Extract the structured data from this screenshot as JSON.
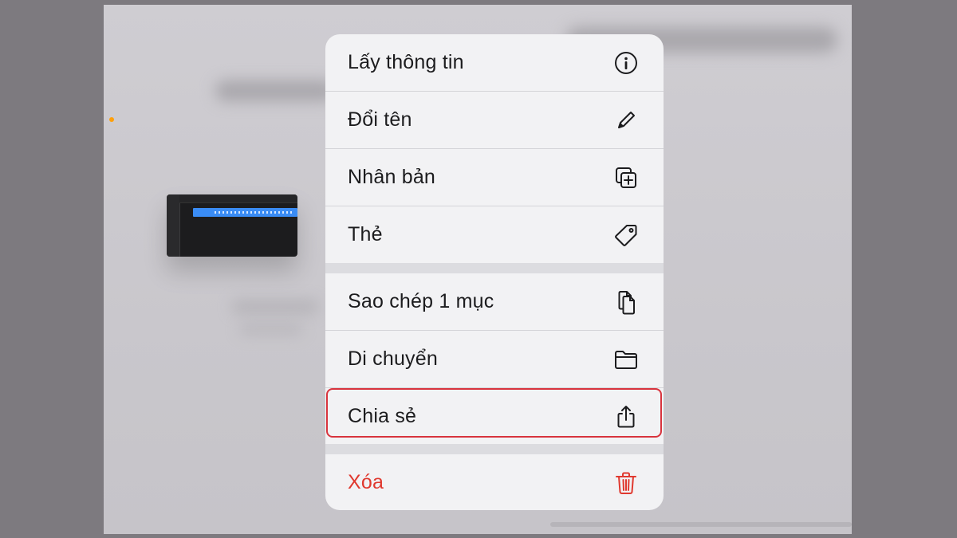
{
  "menu": {
    "group1": [
      {
        "label": "Lấy thông tin",
        "icon": "info-icon"
      },
      {
        "label": "Đổi tên",
        "icon": "pencil-icon"
      },
      {
        "label": "Nhân bản",
        "icon": "duplicate-icon"
      },
      {
        "label": "Thẻ",
        "icon": "tag-icon"
      }
    ],
    "group2": [
      {
        "label": "Sao chép 1 mục",
        "icon": "copy-icon"
      },
      {
        "label": "Di chuyển",
        "icon": "folder-icon"
      },
      {
        "label": "Chia sẻ",
        "icon": "share-icon",
        "highlighted": true
      }
    ],
    "group3": [
      {
        "label": "Xóa",
        "icon": "trash-icon",
        "destructive": true
      }
    ]
  },
  "colors": {
    "destructive": "#e0392f",
    "highlight_border": "#d8333d",
    "accent_region": "#3a8cf5",
    "orange_dot": "#ff9f0a"
  }
}
